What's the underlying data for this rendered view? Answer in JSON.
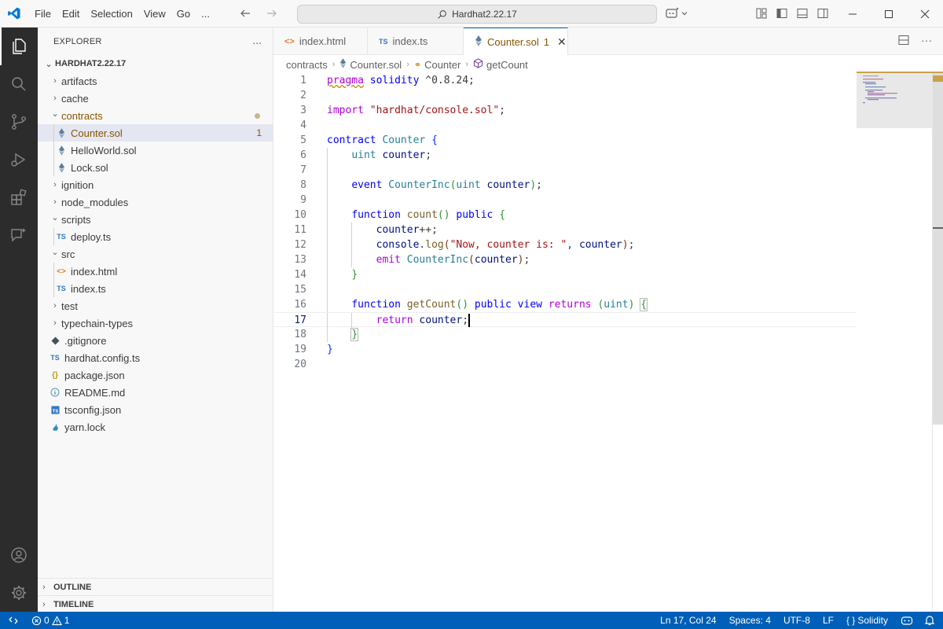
{
  "titlebar": {
    "menu": [
      "File",
      "Edit",
      "Selection",
      "View",
      "Go"
    ],
    "more": "...",
    "command_center": "Hardhat2.22.17"
  },
  "sidebar": {
    "title": "EXPLORER",
    "more": "...",
    "root": "HARDHAT2.22.17",
    "tree": [
      {
        "label": "artifacts",
        "type": "folder",
        "open": false,
        "depth": 0
      },
      {
        "label": "cache",
        "type": "folder",
        "open": false,
        "depth": 0
      },
      {
        "label": "contracts",
        "type": "folder",
        "open": true,
        "depth": 0,
        "modified": true
      },
      {
        "label": "Counter.sol",
        "type": "sol",
        "depth": 1,
        "badge": "1",
        "selected": true,
        "modified": true
      },
      {
        "label": "HelloWorld.sol",
        "type": "sol",
        "depth": 1
      },
      {
        "label": "Lock.sol",
        "type": "sol",
        "depth": 1
      },
      {
        "label": "ignition",
        "type": "folder",
        "open": false,
        "depth": 0
      },
      {
        "label": "node_modules",
        "type": "folder",
        "open": false,
        "depth": 0
      },
      {
        "label": "scripts",
        "type": "folder",
        "open": true,
        "depth": 0
      },
      {
        "label": "deploy.ts",
        "type": "ts",
        "depth": 1
      },
      {
        "label": "src",
        "type": "folder",
        "open": true,
        "depth": 0
      },
      {
        "label": "index.html",
        "type": "html",
        "depth": 1
      },
      {
        "label": "index.ts",
        "type": "ts",
        "depth": 1
      },
      {
        "label": "test",
        "type": "folder",
        "open": false,
        "depth": 0
      },
      {
        "label": "typechain-types",
        "type": "folder",
        "open": false,
        "depth": 0
      },
      {
        "label": ".gitignore",
        "type": "git",
        "depth": 0
      },
      {
        "label": "hardhat.config.ts",
        "type": "ts",
        "depth": 0
      },
      {
        "label": "package.json",
        "type": "json",
        "depth": 0
      },
      {
        "label": "README.md",
        "type": "info",
        "depth": 0
      },
      {
        "label": "tsconfig.json",
        "type": "tsconfig",
        "depth": 0
      },
      {
        "label": "yarn.lock",
        "type": "yarn",
        "depth": 0
      }
    ],
    "outline": "OUTLINE",
    "timeline": "TIMELINE"
  },
  "tabs": [
    {
      "label": "index.html",
      "icon": "html-icon",
      "prefix": "<>",
      "active": false
    },
    {
      "label": "index.ts",
      "icon": "ts-icon",
      "prefix": "TS",
      "active": false
    },
    {
      "label": "Counter.sol",
      "icon": "solidity-icon",
      "badge": "1",
      "active": true
    }
  ],
  "breadcrumb": [
    "contracts",
    "Counter.sol",
    "Counter",
    "getCount"
  ],
  "editor": {
    "current_line": 17,
    "lines": [
      "pragma solidity ^0.8.24;",
      "",
      "import \"hardhat/console.sol\";",
      "",
      "contract Counter {",
      "    uint counter;",
      "",
      "    event CounterInc(uint counter);",
      "",
      "    function count() public {",
      "        counter++;",
      "        console.log(\"Now, counter is: \", counter);",
      "        emit CounterInc(counter);",
      "    }",
      "",
      "    function getCount() public view returns (uint) {",
      "        return counter;",
      "    }",
      "}",
      ""
    ]
  },
  "statusbar": {
    "errors": "0",
    "warnings": "1",
    "position": "Ln 17, Col 24",
    "spaces": "Spaces: 4",
    "encoding": "UTF-8",
    "eol": "LF",
    "language": "Solidity",
    "language_icon": "{ }"
  },
  "colors": {
    "accent": "#005fb8",
    "activity_bar": "#2c2c2c",
    "modified": "#895503"
  }
}
